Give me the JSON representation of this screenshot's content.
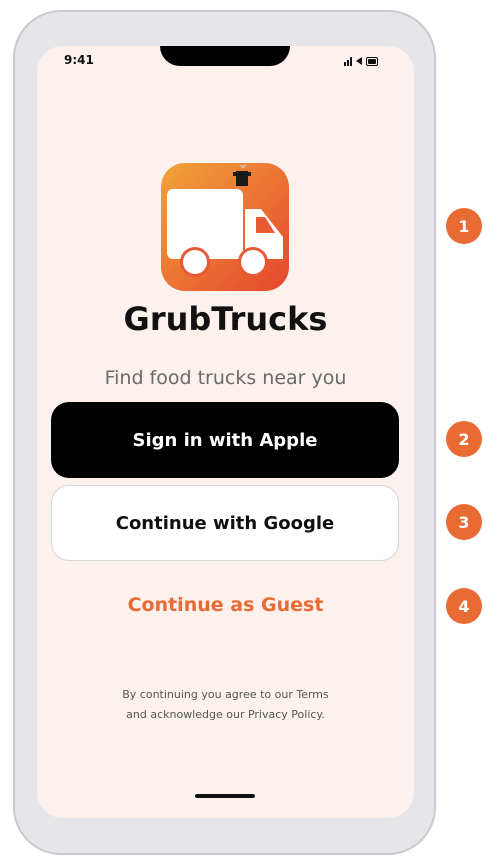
{
  "status_bar": {
    "time": "9:41"
  },
  "app": {
    "name": "GrubTrucks",
    "tagline": "Find food trucks near you",
    "icon": "food-truck-icon"
  },
  "buttons": {
    "apple": "Sign in with Apple",
    "google": "Continue with Google",
    "guest": "Continue as Guest"
  },
  "legal": {
    "line1": "By continuing you agree to our Terms",
    "line2": "and acknowledge our Privacy Policy."
  },
  "callouts": [
    "1",
    "2",
    "3",
    "4"
  ],
  "colors": {
    "accent": "#e86b34",
    "screen_bg": "#fcf1ec",
    "apple_button": "#000000"
  }
}
